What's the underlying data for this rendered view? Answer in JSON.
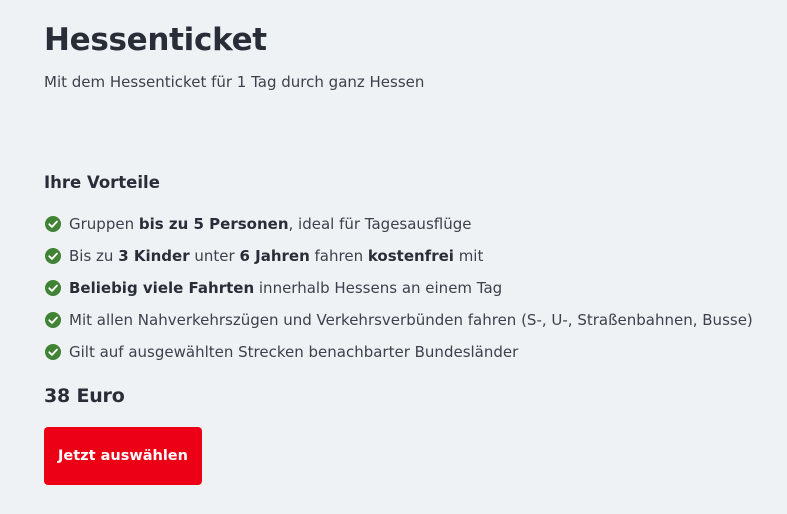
{
  "product": {
    "title": "Hessenticket",
    "subtitle": "Mit dem Hessenticket für 1 Tag durch ganz Hessen"
  },
  "benefits": {
    "heading": "Ihre Vorteile",
    "icon": "check-circle-icon",
    "icon_color": "#408335",
    "items": [
      {
        "parts": [
          {
            "text": "Gruppen "
          },
          {
            "text": "bis zu 5 Personen",
            "bold": true
          },
          {
            "text": ", ideal für Tagesausflüge"
          }
        ]
      },
      {
        "parts": [
          {
            "text": "Bis zu "
          },
          {
            "text": "3 Kinder",
            "bold": true
          },
          {
            "text": " unter "
          },
          {
            "text": "6 Jahren",
            "bold": true
          },
          {
            "text": " fahren "
          },
          {
            "text": "kostenfrei",
            "bold": true
          },
          {
            "text": " mit"
          }
        ]
      },
      {
        "parts": [
          {
            "text": "Beliebig viele Fahrten",
            "bold": true
          },
          {
            "text": " innerhalb Hessens an einem Tag"
          }
        ]
      },
      {
        "parts": [
          {
            "text": "Mit allen Nahverkehrszügen und Verkehrsverbünden fahren (S-, U-, Straßenbahnen, Busse)"
          }
        ]
      },
      {
        "parts": [
          {
            "text": "Gilt auf ausgewählten Strecken benachbarter Bundesländer"
          }
        ]
      }
    ]
  },
  "price": {
    "label": "38 Euro"
  },
  "cta": {
    "label": "Jetzt auswählen",
    "color": "#ec0016"
  }
}
